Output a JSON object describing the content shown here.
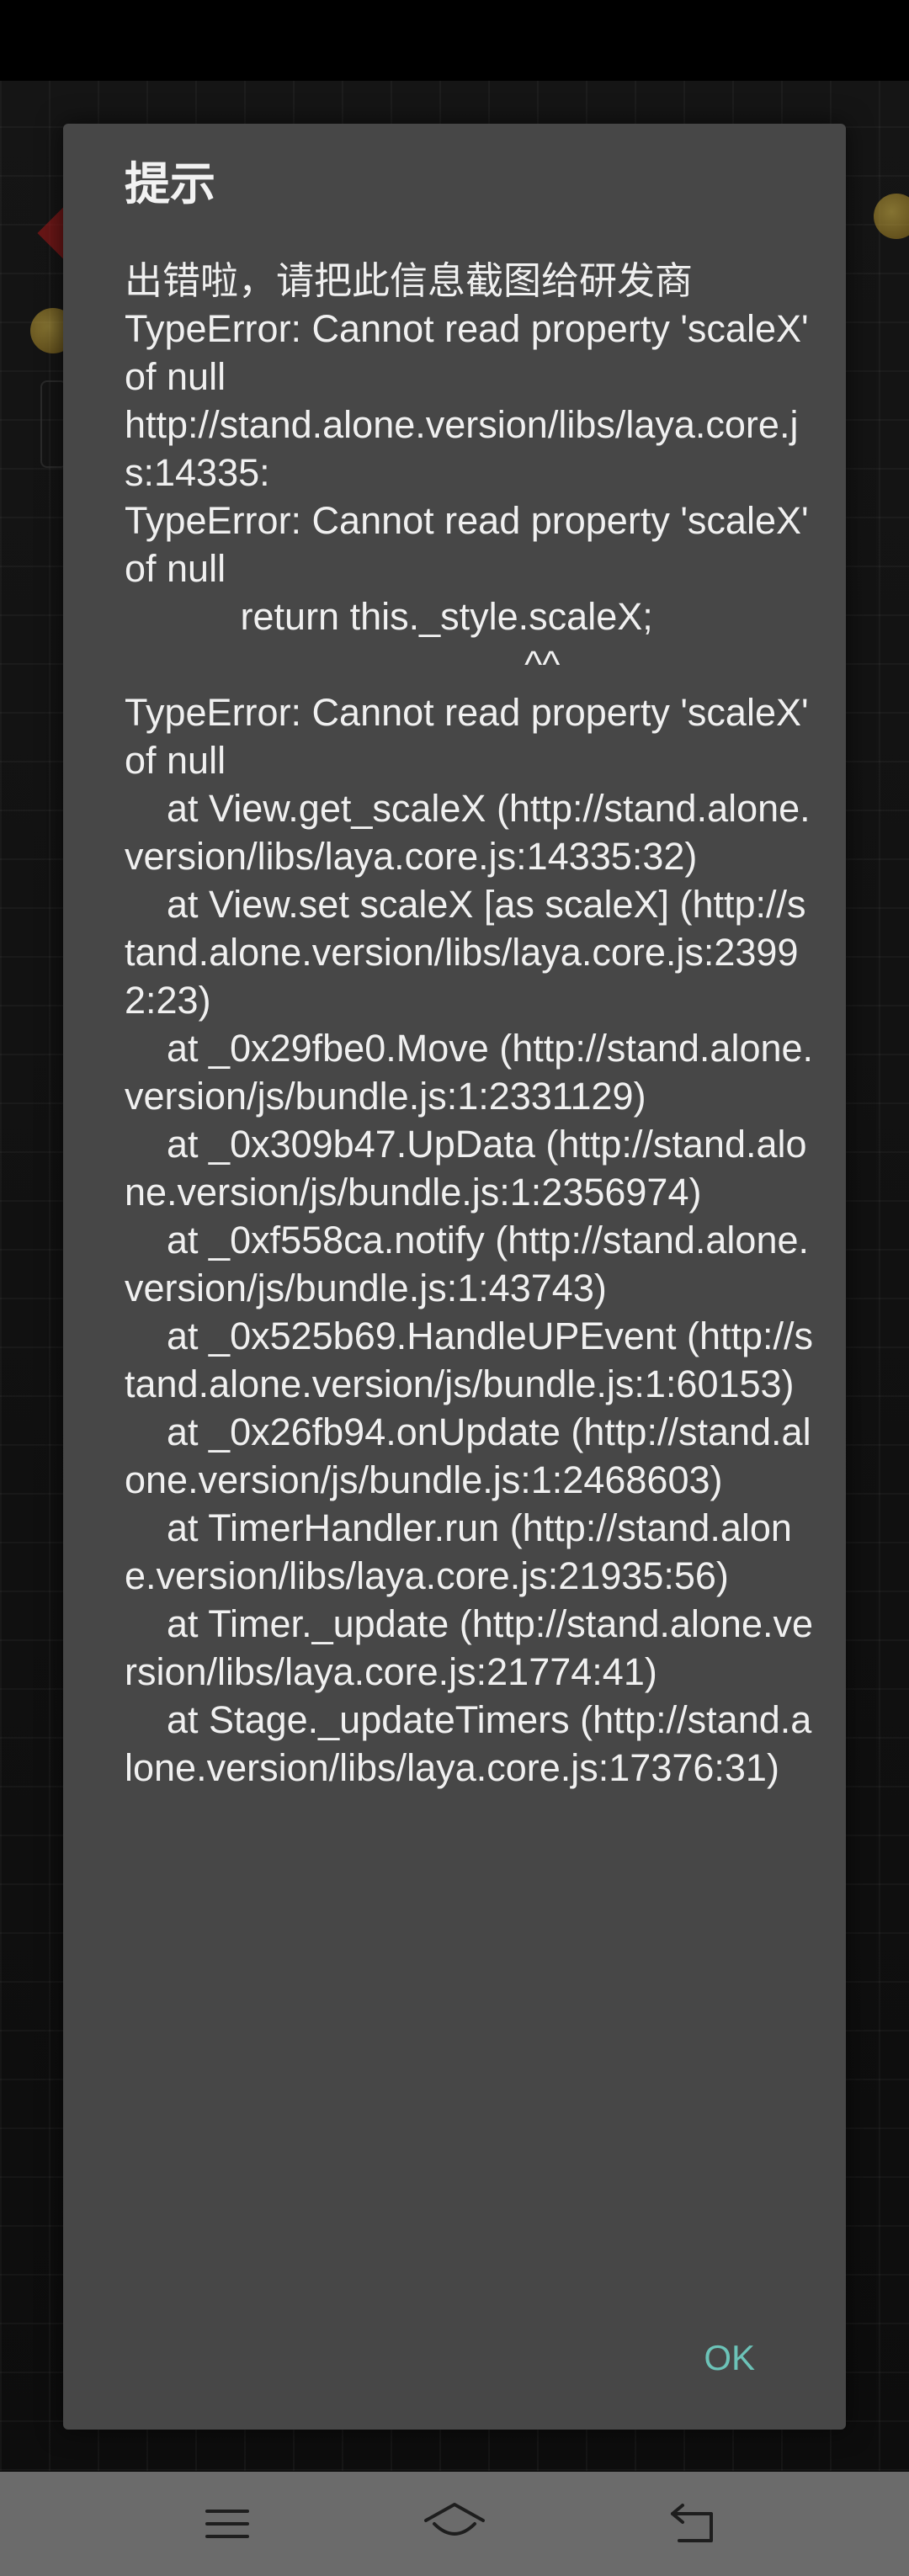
{
  "dialog": {
    "title": "提示",
    "message": "出错啦，请把此信息截图给研发商\nTypeError: Cannot read property 'scaleX' of null\nhttp://stand.alone.version/libs/laya.core.js:14335:\nTypeError: Cannot read property 'scaleX' of null\n           return this._style.scaleX;\n                                      ^^\nTypeError: Cannot read property 'scaleX' of null\n    at View.get_scaleX (http://stand.alone.version/libs/laya.core.js:14335:32)\n    at View.set scaleX [as scaleX] (http://stand.alone.version/libs/laya.core.js:23992:23)\n    at _0x29fbe0.Move (http://stand.alone.version/js/bundle.js:1:2331129)\n    at _0x309b47.UpData (http://stand.alone.version/js/bundle.js:1:2356974)\n    at _0xf558ca.notify (http://stand.alone.version/js/bundle.js:1:43743)\n    at _0x525b69.HandleUPEvent (http://stand.alone.version/js/bundle.js:1:60153)\n    at _0x26fb94.onUpdate (http://stand.alone.version/js/bundle.js:1:2468603)\n    at TimerHandler.run (http://stand.alone.version/libs/laya.core.js:21935:56)\n    at Timer._update (http://stand.alone.version/libs/laya.core.js:21774:41)\n    at Stage._updateTimers (http://stand.alone.version/libs/laya.core.js:17376:31)",
    "ok_label": "OK",
    "colors": {
      "background": "#474747",
      "text": "#f0f0f0",
      "accent": "#6cc3b8"
    }
  },
  "nav_bar": {
    "background": "#6b6b6b",
    "icons": [
      "menu-icon",
      "home-icon",
      "back-icon"
    ]
  }
}
